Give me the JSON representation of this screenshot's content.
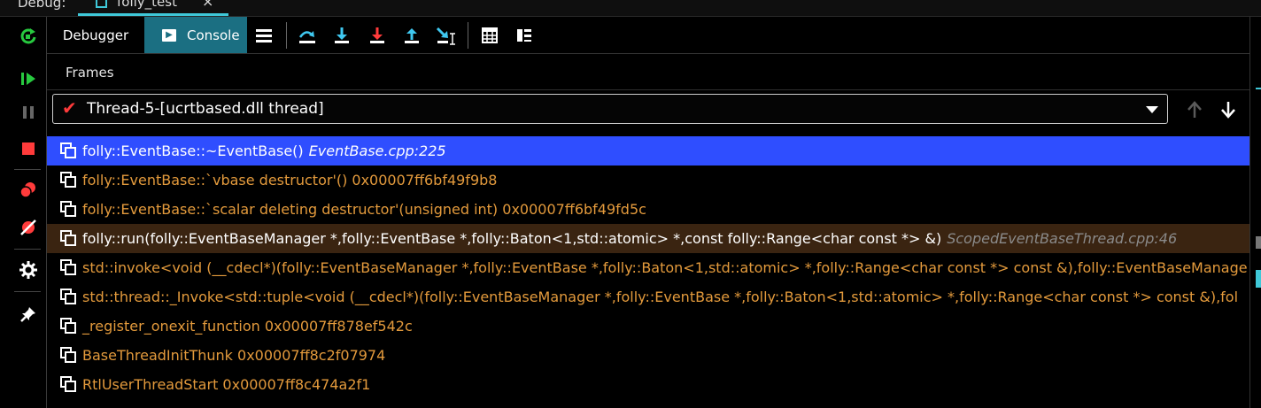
{
  "window": {
    "debug_label": "Debug:",
    "session_tab": "folly_test",
    "session_close": "×"
  },
  "colors": {
    "accent": "#3fc8d8",
    "selection": "#2f4eff",
    "highlight_row": "#3a2411",
    "frame_orange": "#e39a3c",
    "resume_green": "#27c93f",
    "stop_red": "#ff3b3b",
    "step_blue": "#3fc8f0"
  },
  "toolbar": {
    "tab_debugger": "Debugger",
    "tab_console": "Console",
    "icons": [
      "menu-icon",
      "step-over-icon",
      "step-into-icon",
      "force-step-into-icon",
      "step-out-icon",
      "run-to-cursor-icon",
      "evaluate-expression-icon",
      "layout-icon"
    ]
  },
  "left_toolbar": {
    "icons": [
      "rerun-icon",
      "resume-icon",
      "pause-icon",
      "stop-icon",
      "view-breakpoints-icon",
      "mute-breakpoints-icon",
      "settings-icon",
      "pin-icon"
    ]
  },
  "frames": {
    "title": "Frames",
    "thread": "Thread-5-[ucrtbased.dll thread]",
    "items": [
      {
        "name": "folly::EventBase::~EventBase()",
        "location": "EventBase.cpp:225",
        "style": "selected"
      },
      {
        "name": "folly::EventBase::`vbase destructor'() 0x00007ff6bf49f9b8",
        "location": "",
        "style": "library"
      },
      {
        "name": "folly::EventBase::`scalar deleting destructor'(unsigned int) 0x00007ff6bf49fd5c",
        "location": "",
        "style": "library"
      },
      {
        "name": "folly::run(folly::EventBaseManager *,folly::EventBase *,folly::Baton<1,std::atomic> *,const folly::Range<char const *> &)",
        "location": "ScopedEventBaseThread.cpp:46",
        "style": "highlight"
      },
      {
        "name": "std::invoke<void (__cdecl*)(folly::EventBaseManager *,folly::EventBase *,folly::Baton<1,std::atomic> *,folly::Range<char const *> const &),folly::EventBaseManage",
        "location": "",
        "style": "library"
      },
      {
        "name": "std::thread::_Invoke<std::tuple<void (__cdecl*)(folly::EventBaseManager *,folly::EventBase *,folly::Baton<1,std::atomic> *,folly::Range<char const *> const &),fol",
        "location": "",
        "style": "library"
      },
      {
        "name": "_register_onexit_function 0x00007ff878ef542c",
        "location": "",
        "style": "library"
      },
      {
        "name": "BaseThreadInitThunk 0x00007ff8c2f07974",
        "location": "",
        "style": "library"
      },
      {
        "name": "RtlUserThreadStart 0x00007ff8c474a2f1",
        "location": "",
        "style": "library"
      }
    ]
  }
}
